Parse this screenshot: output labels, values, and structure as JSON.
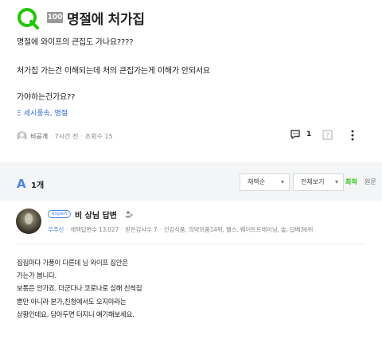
{
  "question": {
    "points": "100",
    "title": "명절에 처가집",
    "body_lines": [
      "명절에 와이프의 큰집도 가나요????",
      "처가집 가는건 이해되는데 처의 큰집가는게 이해가 안되서요",
      "가야하는건가요??"
    ],
    "tag": "세시풍속, 명절",
    "author": "비공개",
    "time_ago": "7시간 전",
    "views": "조회수 15",
    "comment_count": "1"
  },
  "answers": {
    "icon_label": "A",
    "count_label": "1개",
    "sort_select": "채택순",
    "view_select": "전체보기",
    "sort_latest": "최적",
    "sort_original": "원문"
  },
  "answer": {
    "badge": "expert",
    "name": "비 상님 답변",
    "level": "우주신",
    "adopted": "채택답변수 13,027",
    "thanks": "받은감사수 7",
    "fields": "건강식품, 의약외품14위, 웰스, 웨이트트레이닝, 술, 답배36위",
    "lines": [
      "집집마다 가풍이 다른데 님 와이프 집안은",
      "가는가 봅니다.",
      "보통은 안가죠. 더군다나 코로나로 심해 친척집",
      "뿐만 아니라 본가,친청에서도 오지마라는",
      "상황인데요. 담아두면 터지니 얘기해보세요."
    ]
  },
  "colors": {
    "brand_green": "#1ec800",
    "accent_blue": "#4a86e8"
  },
  "icons": [
    "q-logo-icon",
    "tag-icon",
    "comment-icon",
    "share-icon",
    "more-icon",
    "follow-icon",
    "chevron-down-icon"
  ]
}
